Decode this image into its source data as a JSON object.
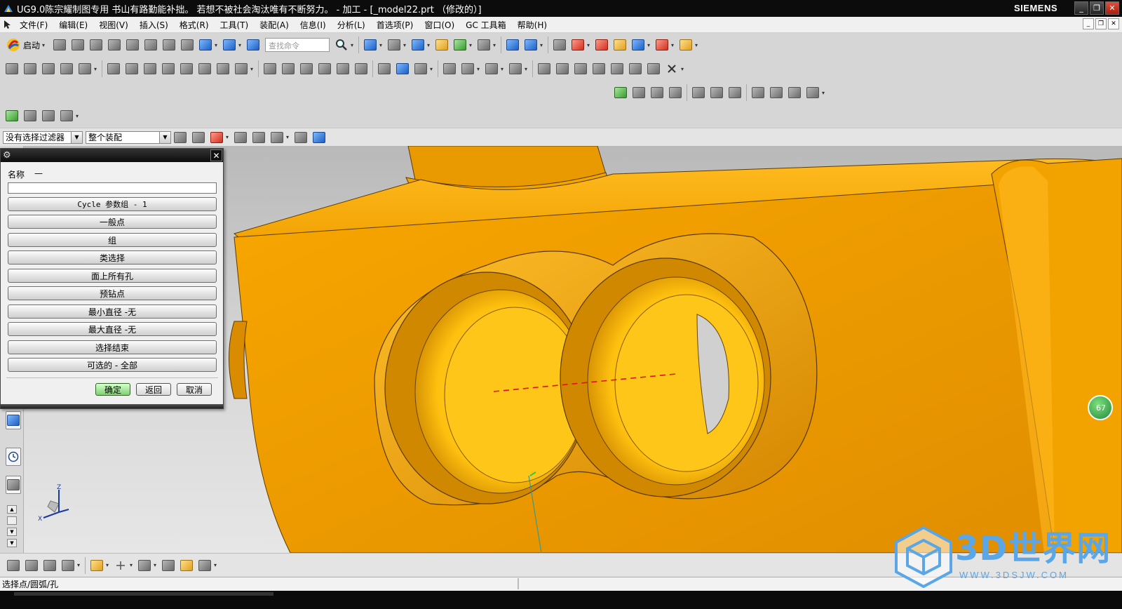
{
  "window": {
    "title": "UG9.0陈宗耀制图专用 书山有路勤能补拙。 若想不被社会淘汰唯有不断努力。 - 加工 - [_model22.prt （修改的）]",
    "brand": "SIEMENS",
    "controls": [
      "_",
      "❐",
      "✕"
    ]
  },
  "menubar": {
    "items": [
      "文件(F)",
      "编辑(E)",
      "视图(V)",
      "插入(S)",
      "格式(R)",
      "工具(T)",
      "装配(A)",
      "信息(I)",
      "分析(L)",
      "首选项(P)",
      "窗口(O)",
      "GC 工具箱",
      "帮助(H)"
    ]
  },
  "toolbar": {
    "start_label": "启动",
    "search_placeholder": "查找命令"
  },
  "filter": {
    "selection_filter": "没有选择过滤器",
    "scope": "整个装配"
  },
  "dialog": {
    "name_label": "名称",
    "name_value": "—",
    "buttons": [
      "Cycle 参数组 - 1",
      "一般点",
      "组",
      "类选择",
      "面上所有孔",
      "预钻点",
      "最小直径 -无",
      "最大直径 -无",
      "选择结束",
      "可选的 - 全部"
    ],
    "ok": "确定",
    "back": "返回",
    "cancel": "取消"
  },
  "viewport": {
    "triad_labels": [
      "Z",
      "X"
    ],
    "badge": "67"
  },
  "status": {
    "prompt": "选择点/圆弧/孔"
  },
  "watermark": {
    "text": "3D世界网",
    "url": "WWW.3DSJW.COM"
  },
  "colors": {
    "model": "#f5a200",
    "model_dark": "#c27c00",
    "hole_inner": "#ffc21a",
    "titlebar": "#0c0c0c",
    "watermark": "#5aa6e6"
  }
}
